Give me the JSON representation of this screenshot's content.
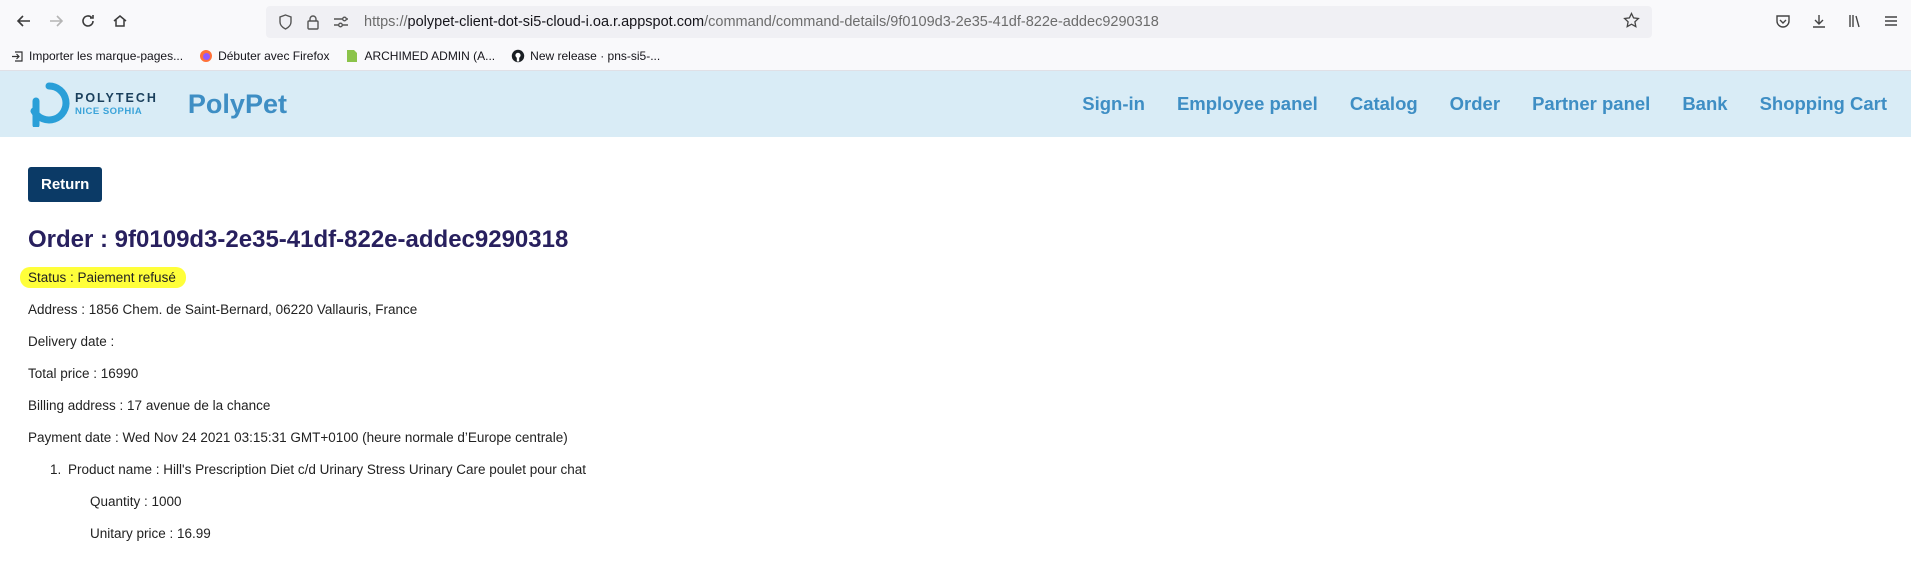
{
  "browser": {
    "url_scheme": "https://",
    "url_host": "polypet-client-dot-si5-cloud-i.oa.r.appspot.com",
    "url_path": "/command/command-details/9f0109d3-2e35-41df-822e-addec9290318",
    "bookmarks": [
      {
        "label": "Importer les marque-pages...",
        "icon": "import-icon"
      },
      {
        "label": "Débuter avec Firefox",
        "icon": "firefox-icon"
      },
      {
        "label": "ARCHIMED ADMIN (A...",
        "icon": "archimed-icon"
      },
      {
        "label": "New release · pns-si5-...",
        "icon": "github-icon"
      }
    ]
  },
  "header": {
    "logo_line1": "POLYTECH",
    "logo_line2": "NICE SOPHIA",
    "brand": "PolyPet",
    "nav": [
      "Sign-in",
      "Employee panel",
      "Catalog",
      "Order",
      "Partner panel",
      "Bank",
      "Shopping Cart"
    ]
  },
  "main": {
    "return_label": "Return",
    "title": "Order : 9f0109d3-2e35-41df-822e-addec9290318",
    "status": "Status : Paiement refusé",
    "address": "Address : 1856 Chem. de Saint-Bernard, 06220 Vallauris, France",
    "delivery_date": "Delivery date :",
    "total_price": "Total price : 16990",
    "billing_address": "Billing address : 17 avenue de la chance",
    "payment_date": "Payment date : Wed Nov 24 2021 03:15:31 GMT+0100 (heure normale d’Europe centrale)",
    "products": [
      {
        "number": "1.",
        "name": "Product name : Hill's Prescription Diet c/d Urinary Stress Urinary Care poulet pour chat",
        "quantity": "Quantity : 1000",
        "unitary_price": "Unitary price : 16.99"
      }
    ]
  },
  "colors": {
    "header_bg": "#d9ecf6",
    "brand_blue": "#3e8ec4",
    "button_bg": "#0b3a66",
    "title_color": "#28205e",
    "highlight": "#ffff3a"
  }
}
